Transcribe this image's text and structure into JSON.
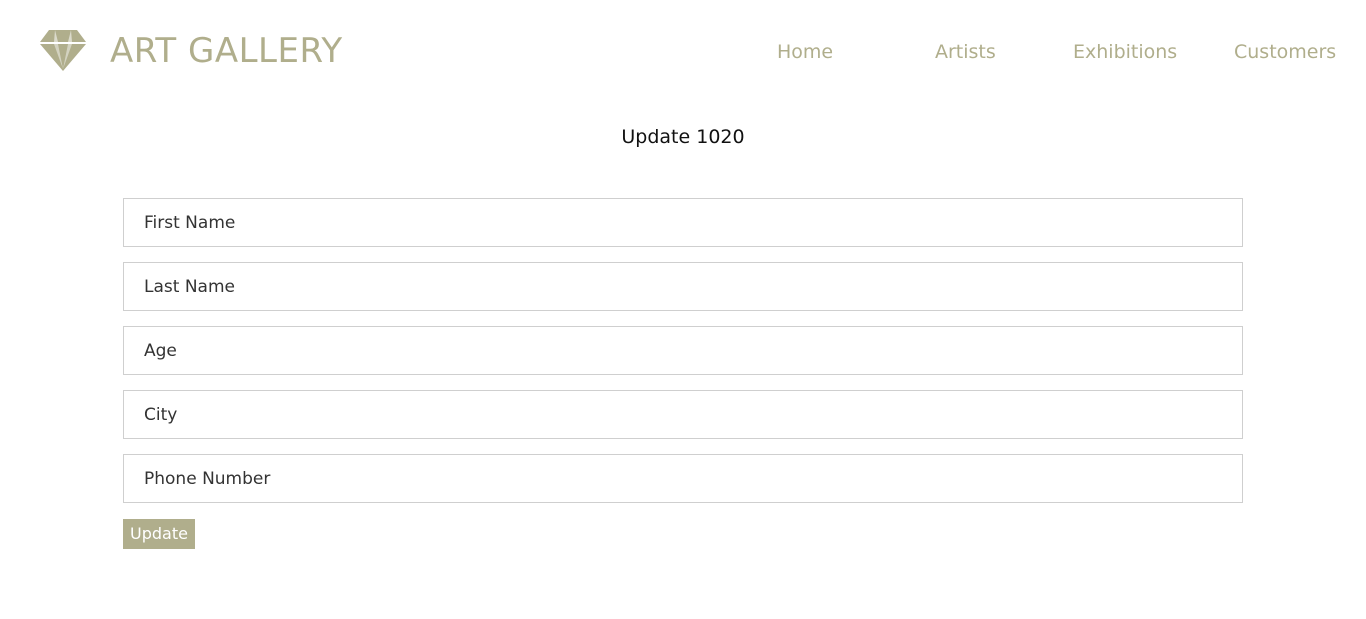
{
  "header": {
    "brand": "ART GALLERY",
    "logo_icon": "diamond-icon",
    "accent_color": "#b0ae8c",
    "nav": {
      "home": "Home",
      "artists": "Artists",
      "exhibitions": "Exhibitions",
      "customers": "Customers"
    }
  },
  "main": {
    "title": "Update 1020",
    "form": {
      "first_name_placeholder": "First Name",
      "last_name_placeholder": "Last Name",
      "age_placeholder": "Age",
      "city_placeholder": "City",
      "phone_placeholder": "Phone Number",
      "submit_label": "Update"
    }
  }
}
